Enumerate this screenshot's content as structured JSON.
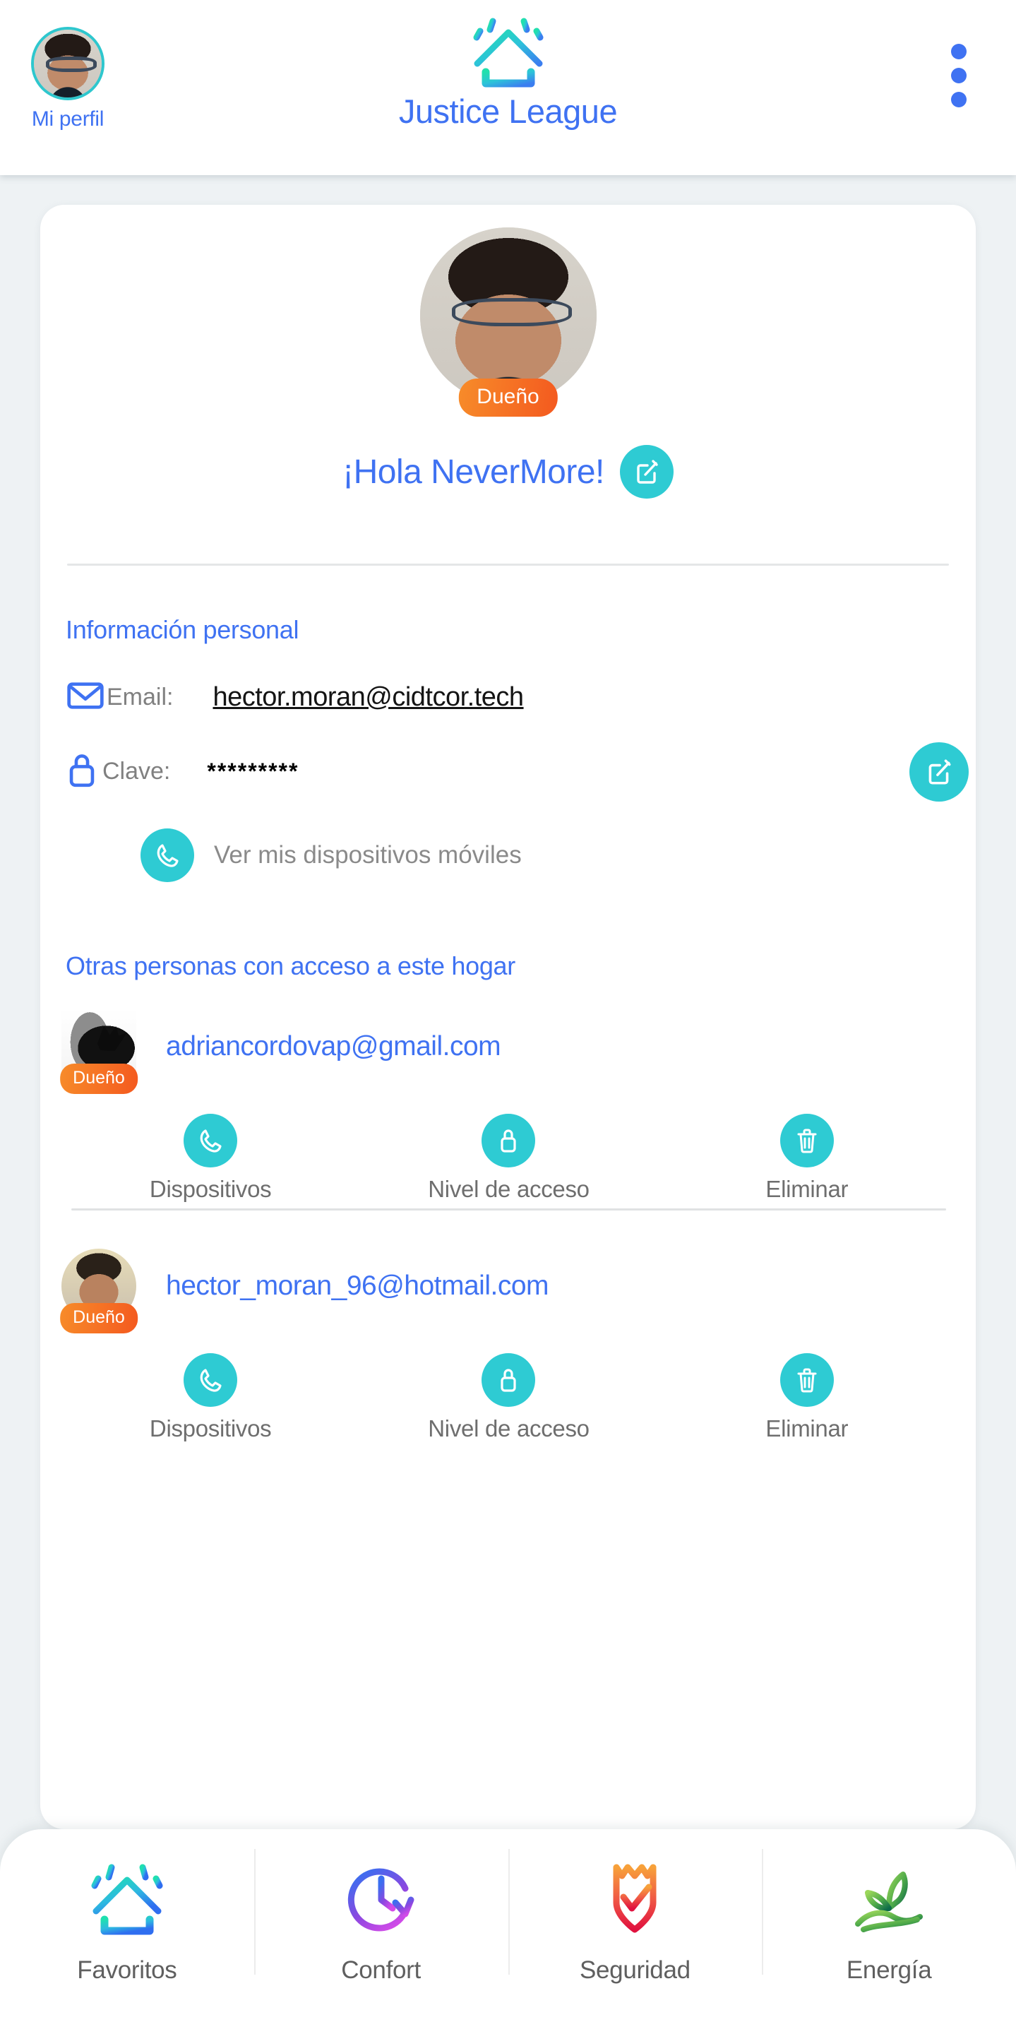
{
  "header": {
    "profile_label": "Mi perfil",
    "brand_title": "Justice League",
    "logo_icon": "home-rays-logo-icon",
    "menu_icon": "kebab-menu-icon",
    "avatar_icon": "user-avatar"
  },
  "hero": {
    "avatar_icon": "user-avatar-large",
    "badge": "Dueño",
    "greeting": "¡Hola NeverMore!",
    "edit_icon": "edit-pencil-square-icon"
  },
  "personal": {
    "title": "Información personal",
    "email_icon": "mail-envelope-icon",
    "email_label": "Email:",
    "email_value": "hector.moran@cidtcor.tech",
    "password_icon": "lock-icon",
    "password_label": "Clave:",
    "password_value": "*********",
    "password_edit_icon": "edit-pencil-square-icon",
    "devices_icon": "phone-handset-icon",
    "devices_label": "Ver mis dispositivos móviles"
  },
  "people": {
    "title": "Otras personas con acceso a este hogar",
    "actions": [
      {
        "label": "Dispositivos",
        "icon": "phone-handset-icon"
      },
      {
        "label": "Nivel de acceso",
        "icon": "lock-icon"
      },
      {
        "label": "Eliminar",
        "icon": "trash-can-icon"
      }
    ],
    "entries": [
      {
        "email": "adriancordovap@gmail.com",
        "badge": "Dueño",
        "avatar_icon": "crow-avatar"
      },
      {
        "email": "hector_moran_96@hotmail.com",
        "badge": "Dueño",
        "avatar_icon": "user-avatar"
      }
    ]
  },
  "bottom_nav": {
    "items": [
      {
        "label": "Favoritos",
        "icon": "home-rays-icon"
      },
      {
        "label": "Confort",
        "icon": "clock-refresh-icon"
      },
      {
        "label": "Seguridad",
        "icon": "shield-check-icon"
      },
      {
        "label": "Energía",
        "icon": "hand-plant-icon"
      }
    ]
  },
  "colors": {
    "accent_blue": "#3f72f2",
    "accent_teal": "#2ecbd3",
    "badge_orange": "#f4591f",
    "page_bg": "#eef2f4",
    "card_bg": "#ffffff",
    "muted_text": "#808080"
  }
}
